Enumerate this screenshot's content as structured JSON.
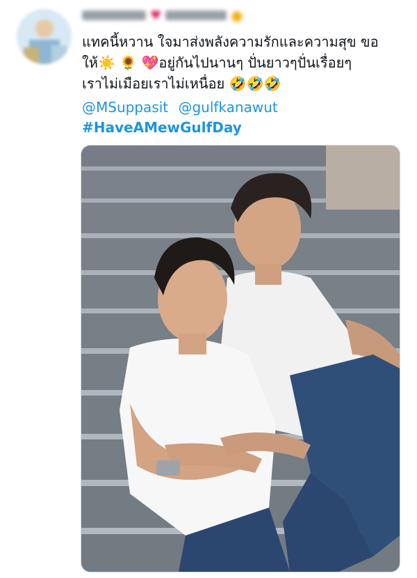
{
  "tweet": {
    "text_lines": [
      "แทคนี้หวาน ใจมาส่งพลังความรักและความสุข ขอ",
      "อยู่กันไปนานๆ ปั่นยาวๆปั่นเรื่อยๆ",
      "เราไม่เมือยเราไม่เหนื่อย"
    ],
    "line2_prefix": "ให้",
    "emojis": {
      "sun": "☀️",
      "sunflower": "🌻",
      "heart": "💖",
      "laugh": "🤣"
    },
    "mentions": [
      "@MSuppasit",
      "@gulfkanawut"
    ],
    "hashtag": "#HaveAMewGulfDay"
  },
  "colors": {
    "link": "#1b95e0",
    "text": "#0f1419",
    "stairs": "#8c929b",
    "shirt": "#f4f4f4",
    "jeans": "#2c4a72"
  }
}
